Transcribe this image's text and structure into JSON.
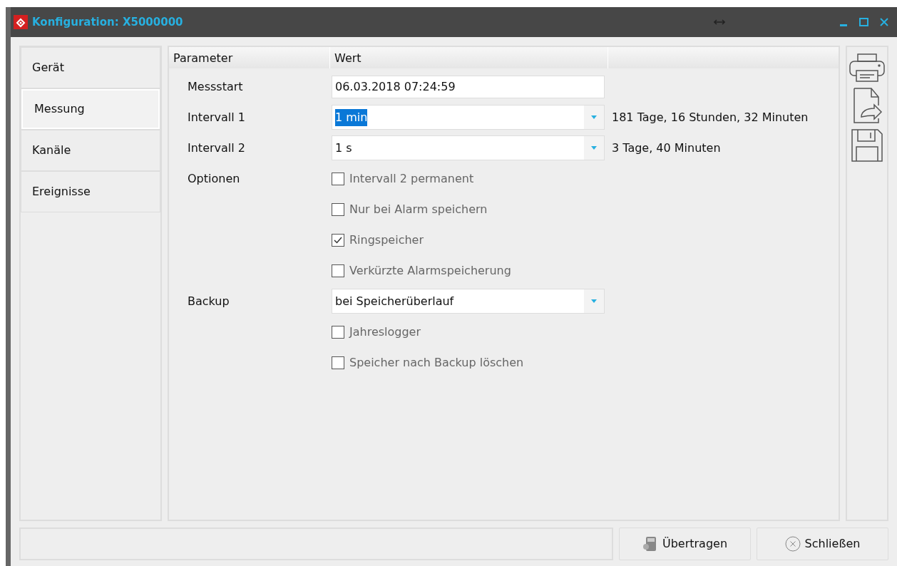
{
  "window": {
    "title": "Konfiguration: X5000000"
  },
  "sidebar": {
    "items": [
      {
        "label": "Gerät",
        "selected": false
      },
      {
        "label": "Messung",
        "selected": true
      },
      {
        "label": "Kanäle",
        "selected": false
      },
      {
        "label": "Ereignisse",
        "selected": false
      }
    ]
  },
  "table": {
    "columns": [
      "Parameter",
      "Wert"
    ],
    "rows": [
      {
        "kind": "text",
        "label": "Messstart",
        "value": "06.03.2018 07:24:59"
      },
      {
        "kind": "combo",
        "label": "Intervall 1",
        "value": "1 min",
        "focused": true,
        "note": "181 Tage, 16 Stunden, 32 Minuten"
      },
      {
        "kind": "combo",
        "label": "Intervall 2",
        "value": "1 s",
        "focused": false,
        "note": "3 Tage, 40 Minuten"
      },
      {
        "kind": "check",
        "label": "Optionen",
        "text": "Intervall 2 permanent",
        "checked": false
      },
      {
        "kind": "check",
        "text": "Nur bei Alarm speichern",
        "checked": false
      },
      {
        "kind": "check",
        "text": "Ringspeicher",
        "checked": true
      },
      {
        "kind": "check",
        "text": "Verkürzte Alarmspeicherung",
        "checked": false
      },
      {
        "kind": "combo",
        "label": "Backup",
        "value": "bei Speicherüberlauf",
        "focused": false
      },
      {
        "kind": "check",
        "text": "Jahreslogger",
        "checked": false
      },
      {
        "kind": "check",
        "text": "Speicher nach Backup löschen",
        "checked": false
      }
    ]
  },
  "buttons": [
    {
      "kind": "transfer",
      "label": "Übertragen"
    },
    {
      "kind": "close",
      "label": "Schließen"
    }
  ]
}
